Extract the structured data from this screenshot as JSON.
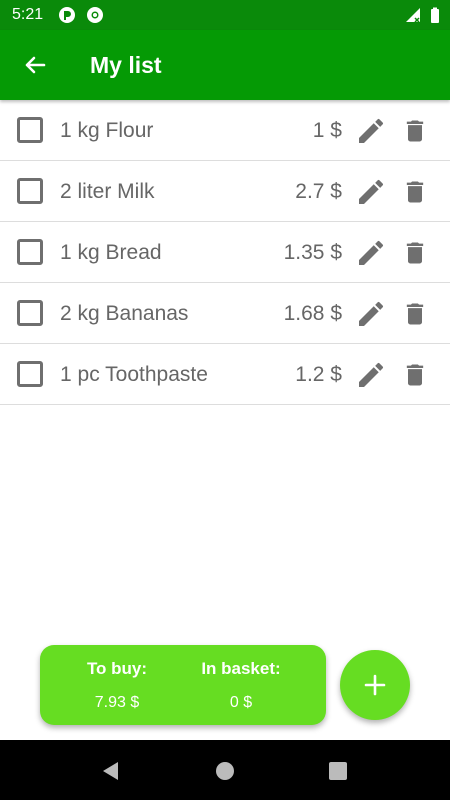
{
  "status_bar": {
    "time": "5:21",
    "icons": [
      "app-notification-icon",
      "chrome-icon",
      "signal-icon",
      "battery-icon"
    ]
  },
  "app_bar": {
    "title": "My list",
    "back_icon": "arrow-back-icon"
  },
  "list": {
    "items": [
      {
        "name": "1 kg Flour",
        "price": "1 $",
        "checked": false
      },
      {
        "name": "2 liter Milk",
        "price": "2.7 $",
        "checked": false
      },
      {
        "name": "1 kg Bread",
        "price": "1.35 $",
        "checked": false
      },
      {
        "name": "2 kg Bananas",
        "price": "1.68 $",
        "checked": false
      },
      {
        "name": "1 pc Toothpaste",
        "price": "1.2 $",
        "checked": false
      }
    ],
    "row_icons": [
      "pencil-icon",
      "trash-icon"
    ]
  },
  "summary": {
    "to_buy_label": "To buy:",
    "to_buy_value": "7.93 $",
    "in_basket_label": "In basket:",
    "in_basket_value": "0 $"
  },
  "fab": {
    "icon": "plus-icon"
  },
  "nav_bar": {
    "icons": [
      "back-triangle-icon",
      "home-circle-icon",
      "recents-square-icon"
    ]
  },
  "colors": {
    "status_bar": "#0a8a0a",
    "app_bar": "#059a05",
    "accent": "#66dd22",
    "text": "#666666",
    "icon": "#6f6f6f"
  }
}
